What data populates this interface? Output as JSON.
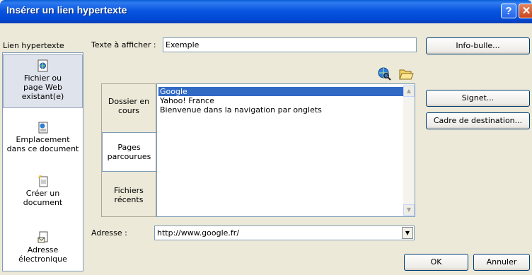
{
  "window": {
    "title": "Insérer un lien hypertexte"
  },
  "titlebar": {
    "help_glyph": "?",
    "close_glyph": "✕"
  },
  "link_section": {
    "label": "Lien hypertexte"
  },
  "sidebar": {
    "items": [
      {
        "label": "Fichier ou page Web existant(e)",
        "icon": "web-page-icon",
        "selected": true
      },
      {
        "label": "Emplacement dans ce document",
        "icon": "document-place-icon",
        "selected": false
      },
      {
        "label": "Créer un document",
        "icon": "new-document-icon",
        "selected": false
      },
      {
        "label": "Adresse électronique",
        "icon": "email-icon",
        "selected": false
      }
    ]
  },
  "display_text": {
    "label": "Texte à afficher :",
    "value": "Exemple"
  },
  "buttons": {
    "tooltip": "Info-bulle...",
    "bookmark": "Signet...",
    "target_frame": "Cadre de destination...",
    "ok": "OK",
    "cancel": "Annuler"
  },
  "toolbar": {
    "browse_web_icon": "globe-search-icon",
    "browse_file_icon": "folder-open-icon"
  },
  "tabs": [
    {
      "label": "Dossier en cours",
      "selected": false
    },
    {
      "label": "Pages parcourues",
      "selected": true
    },
    {
      "label": "Fichiers récents",
      "selected": false
    }
  ],
  "list": {
    "items": [
      {
        "text": "Google",
        "selected": true
      },
      {
        "text": "Yahoo! France",
        "selected": false
      },
      {
        "text": "Bienvenue dans la navigation par onglets",
        "selected": false
      }
    ]
  },
  "address": {
    "label": "Adresse :",
    "value": "http://www.google.fr/"
  },
  "colors": {
    "selection": "#316ac5",
    "titlebar": "#0a56e0",
    "dialog_bg": "#ece9d8"
  }
}
